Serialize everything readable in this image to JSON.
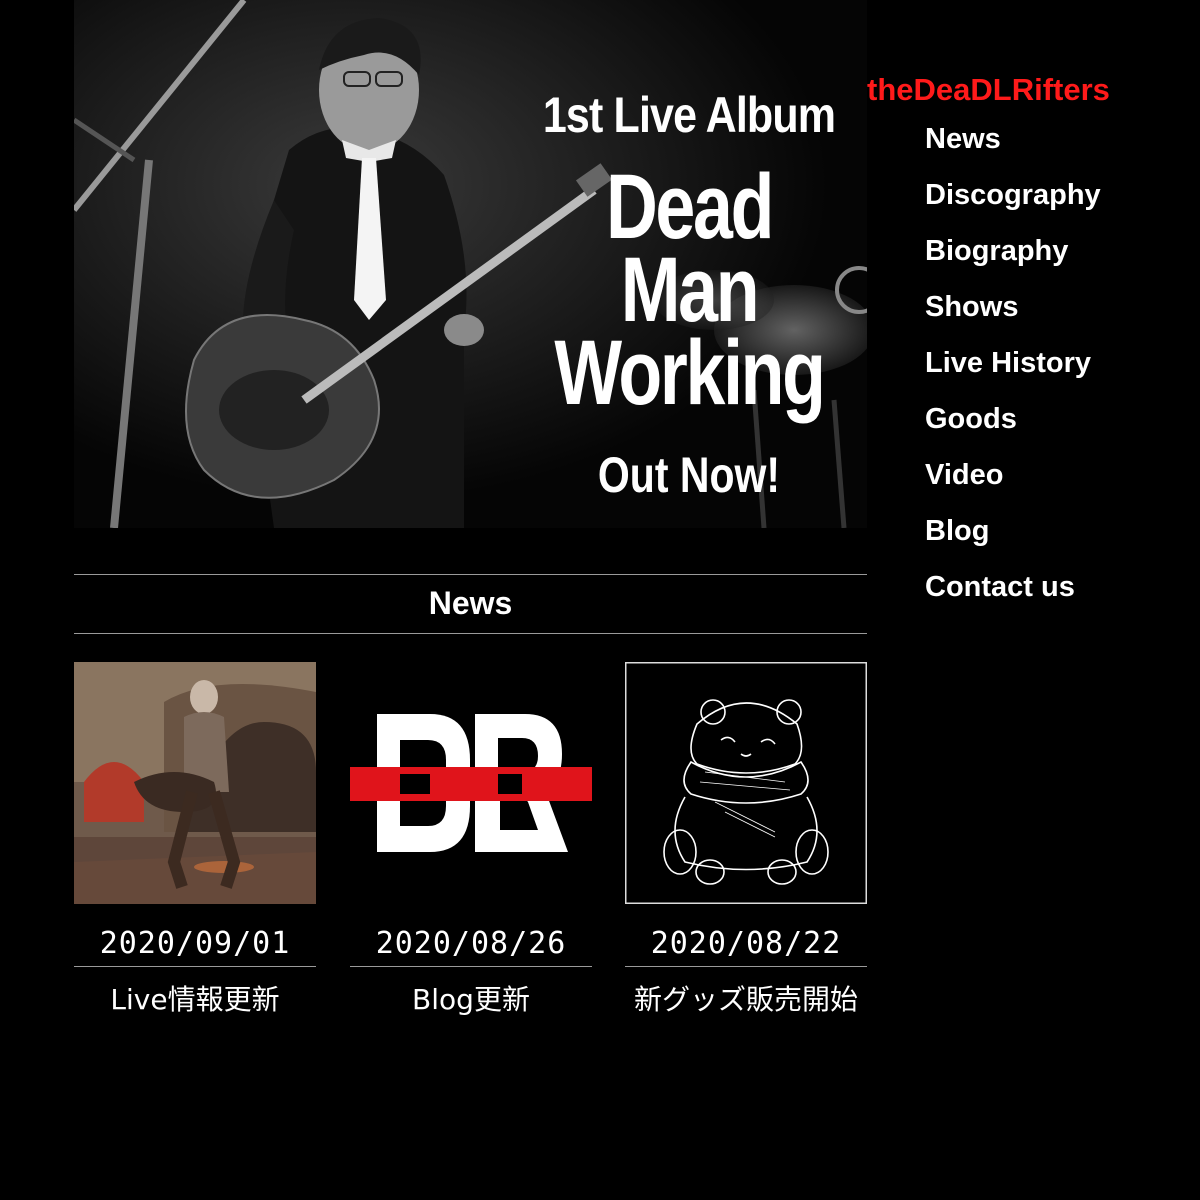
{
  "hero": {
    "subtitle": "1st Live Album",
    "title_line1": "Dead",
    "title_line2": "Man",
    "title_line3": "Working",
    "cta": "Out Now!"
  },
  "brand": "theDeaDLRifters",
  "nav": {
    "items": [
      {
        "label": "News"
      },
      {
        "label": "Discography"
      },
      {
        "label": "Biography"
      },
      {
        "label": "Shows"
      },
      {
        "label": "Live History"
      },
      {
        "label": "Goods"
      },
      {
        "label": "Video"
      },
      {
        "label": "Blog"
      },
      {
        "label": "Contact us"
      }
    ]
  },
  "news": {
    "heading": "News",
    "items": [
      {
        "date": "2020/09/01",
        "title": "Live情報更新",
        "thumb": "bass-player-3d-icon"
      },
      {
        "date": "2020/08/26",
        "title": "Blog更新",
        "thumb": "dl-logo-icon"
      },
      {
        "date": "2020/08/22",
        "title": "新グッズ販売開始",
        "thumb": "panda-sketch-icon"
      }
    ]
  },
  "colors": {
    "background": "#000000",
    "brand": "#ff1a1a",
    "logo_red": "#e0141b",
    "text": "#ffffff"
  }
}
